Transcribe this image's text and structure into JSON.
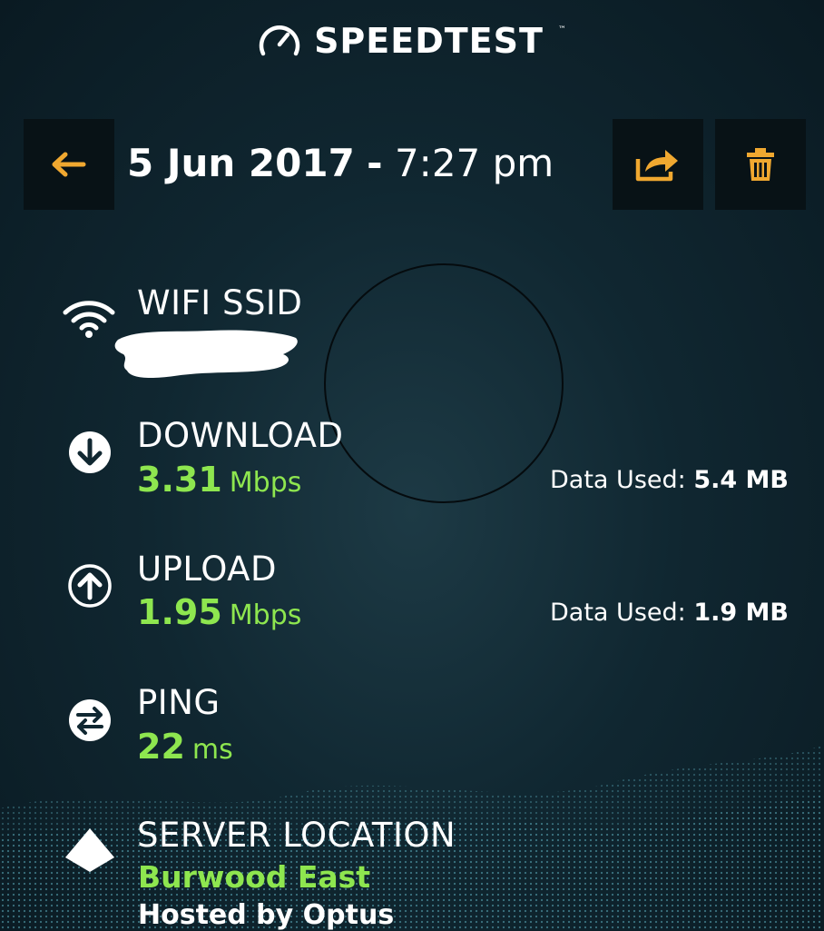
{
  "header": {
    "brand": "SPEEDTEST",
    "trademark": "™"
  },
  "result": {
    "date": "5 Jun 2017",
    "separator": "-",
    "time": "7:27 pm"
  },
  "wifi": {
    "label": "WIFI SSID"
  },
  "download": {
    "label": "DOWNLOAD",
    "value": "3.31",
    "unit": "Mbps",
    "data_used_label": "Data Used:",
    "data_used_value": "5.4 MB"
  },
  "upload": {
    "label": "UPLOAD",
    "value": "1.95",
    "unit": "Mbps",
    "data_used_label": "Data Used:",
    "data_used_value": "1.9 MB"
  },
  "ping": {
    "label": "PING",
    "value": "22",
    "unit": "ms"
  },
  "server": {
    "label": "SERVER LOCATION",
    "name": "Burwood East",
    "hosted": "Hosted by Optus"
  },
  "colors": {
    "accent_orange": "#f0a830",
    "value_green": "#8ee64f",
    "background": "#102731"
  },
  "icons": [
    "speedometer-icon",
    "back-arrow-icon",
    "share-icon",
    "trash-icon",
    "wifi-icon",
    "download-icon",
    "upload-icon",
    "ping-icon",
    "server-location-icon"
  ]
}
